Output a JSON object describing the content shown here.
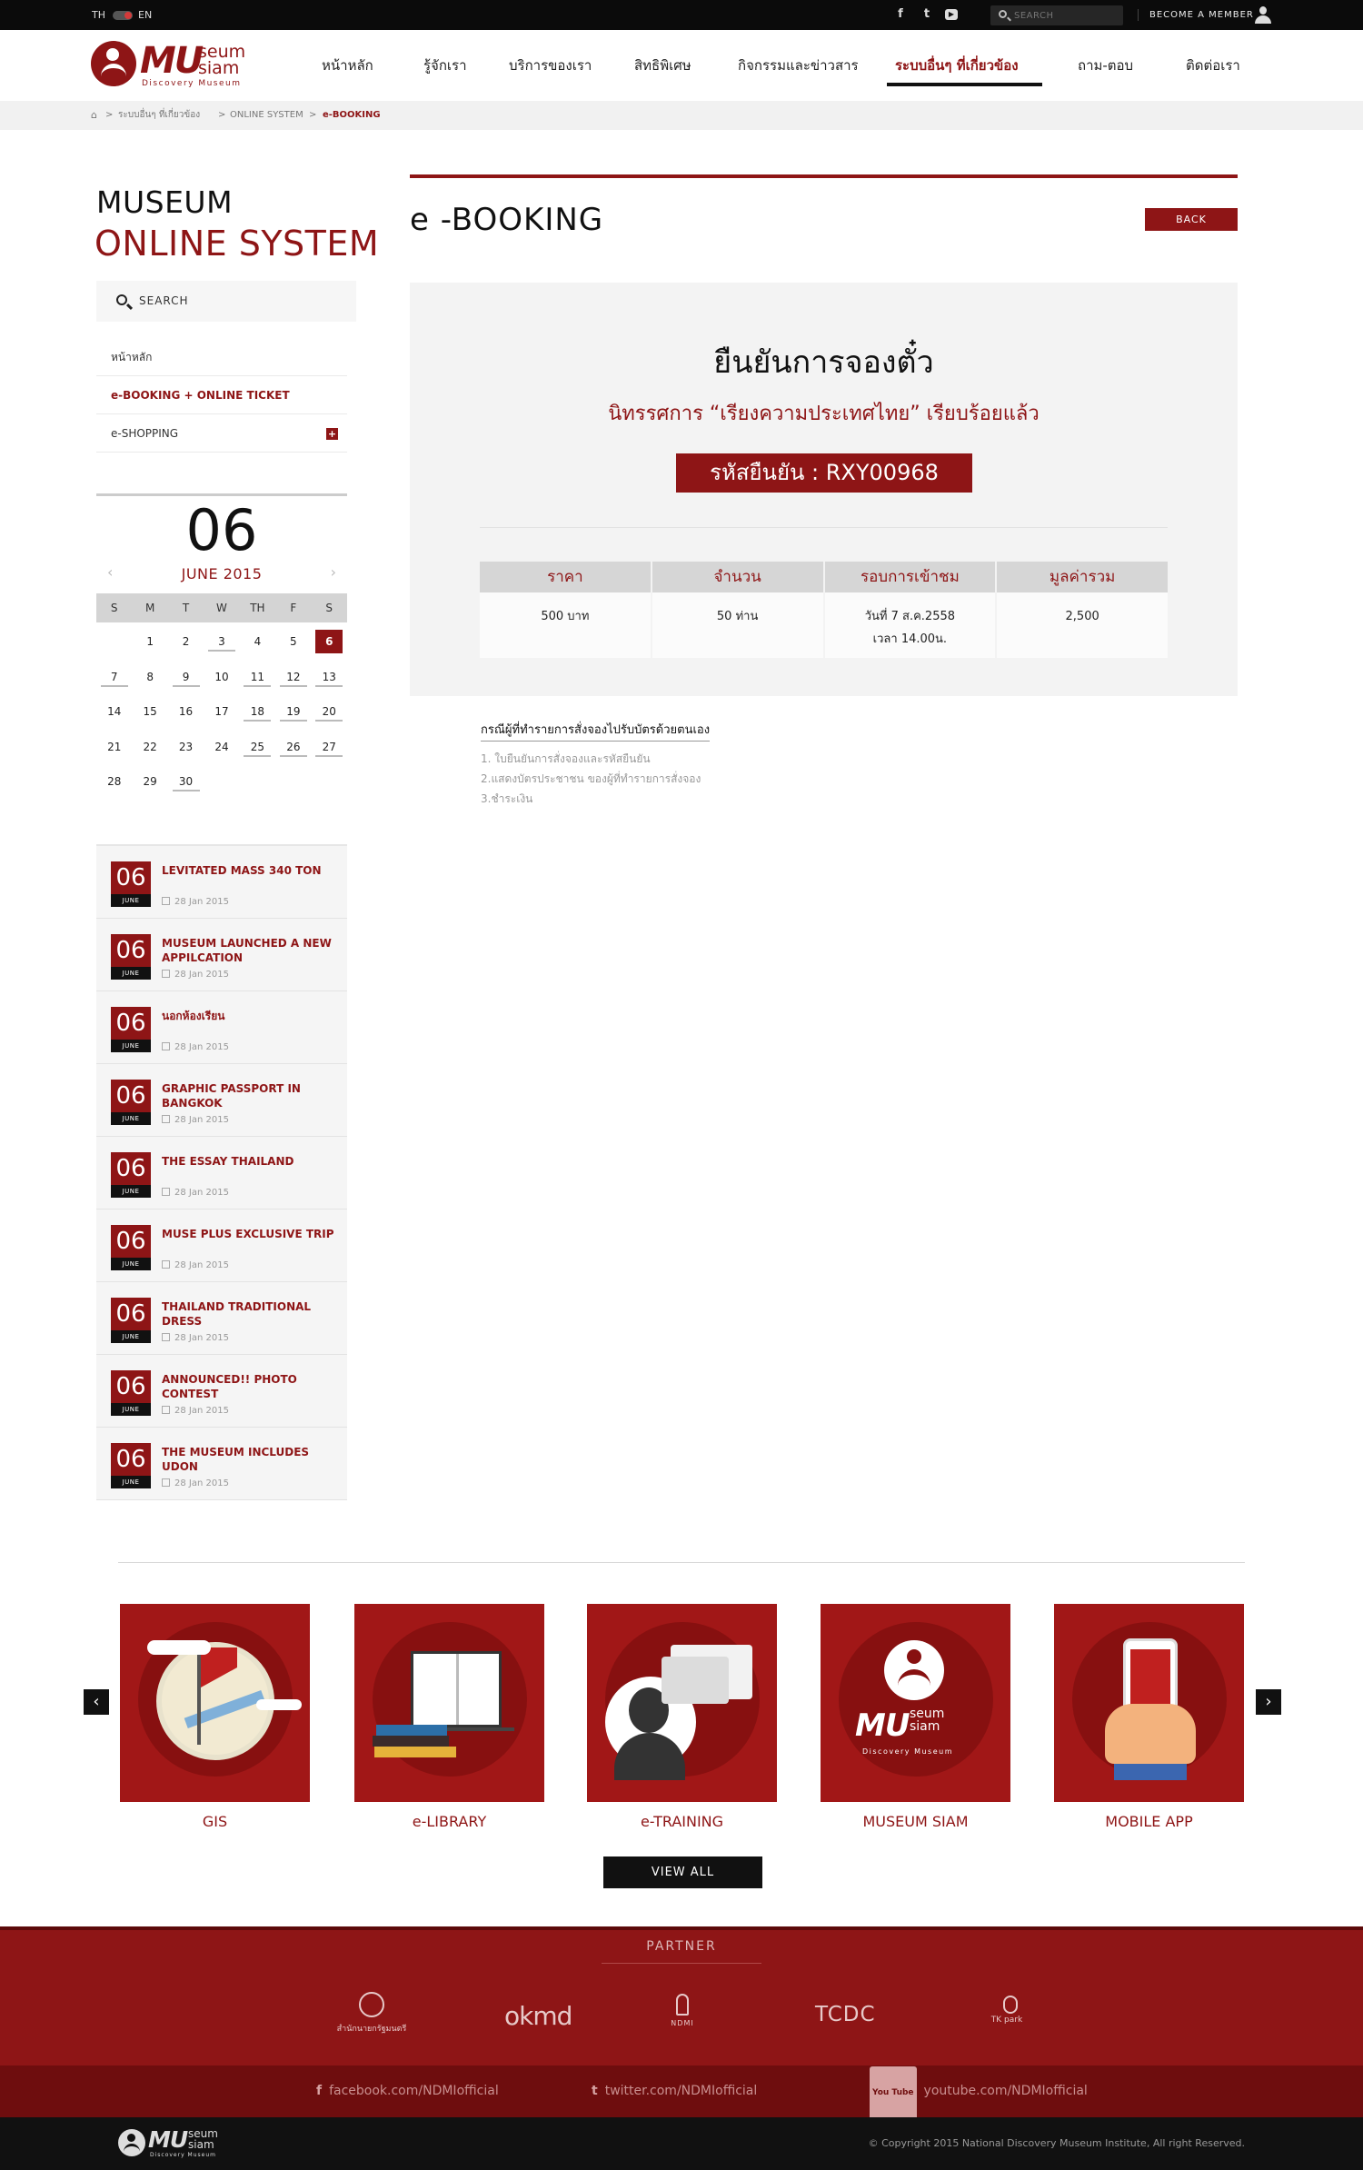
{
  "topbar": {
    "lang_th": "TH",
    "lang_en": "EN",
    "search_placeholder": "SEARCH",
    "member_label": "BECOME A MEMBER",
    "social_icons": [
      "facebook-icon",
      "twitter-icon",
      "youtube-icon"
    ]
  },
  "logo": {
    "mu": "MU",
    "seum": "seum",
    "siam": "siam",
    "subtitle": "Discovery Museum"
  },
  "nav": [
    {
      "label": "หน้าหลัก"
    },
    {
      "label": "รู้จักเรา"
    },
    {
      "label": "บริการของเรา"
    },
    {
      "label": "สิทธิพิเศษ"
    },
    {
      "label": "กิจกรรมและข่าวสาร"
    },
    {
      "label": "ระบบอื่นๆ ที่เกี่ยวข้อง",
      "active": true
    },
    {
      "label": "ถาม-ตอบ"
    },
    {
      "label": "ติดต่อเรา"
    }
  ],
  "breadcrumb": {
    "home_icon": "home-icon",
    "sep": ">",
    "items": [
      "ระบบอื่นๆ ที่เกี่ยวข้อง",
      "ONLINE SYSTEM",
      "e-BOOKING"
    ]
  },
  "sidebar": {
    "title_line1": "MUSEUM",
    "title_line2": "ONLINE SYSTEM",
    "search_label": "SEARCH",
    "menu": [
      {
        "label": "หน้าหลัก"
      },
      {
        "label": "e-BOOKING + ONLINE TICKET",
        "active": true
      },
      {
        "label": "e-SHOPPING",
        "expand": "+"
      }
    ]
  },
  "calendar": {
    "day": "06",
    "month": "JUNE 2015",
    "prev": "‹",
    "next": "›",
    "weekdays": [
      "S",
      "M",
      "T",
      "W",
      "TH",
      "F",
      "S"
    ],
    "selected": 6,
    "event_days": [
      3,
      7,
      9,
      11,
      12,
      13,
      18,
      19,
      20,
      25,
      26,
      27,
      30
    ],
    "first_weekday": 1,
    "days_in_month": 30
  },
  "news": [
    {
      "day": "06",
      "month": "JUNE",
      "title": "LEVITATED MASS 340 TON",
      "date": "28 Jan 2015"
    },
    {
      "day": "06",
      "month": "JUNE",
      "title": "MUSEUM LAUNCHED A NEW APPILCATION",
      "date": "28 Jan 2015"
    },
    {
      "day": "06",
      "month": "JUNE",
      "title": "นอกห้องเรียน",
      "date": "28 Jan 2015"
    },
    {
      "day": "06",
      "month": "JUNE",
      "title": "GRAPHIC PASSPORT IN BANGKOK",
      "date": "28 Jan 2015"
    },
    {
      "day": "06",
      "month": "JUNE",
      "title": "THE ESSAY THAILAND",
      "date": "28 Jan 2015"
    },
    {
      "day": "06",
      "month": "JUNE",
      "title": "MUSE PLUS EXCLUSIVE TRIP",
      "date": "28 Jan 2015"
    },
    {
      "day": "06",
      "month": "JUNE",
      "title": "THAILAND TRADITIONAL DRESS",
      "date": "28 Jan 2015"
    },
    {
      "day": "06",
      "month": "JUNE",
      "title": "ANNOUNCED!! PHOTO CONTEST",
      "date": "28 Jan 2015"
    },
    {
      "day": "06",
      "month": "JUNE",
      "title": "THE MUSEUM INCLUDES UDON",
      "date": "28 Jan 2015"
    }
  ],
  "main": {
    "title": "e -BOOKING",
    "back_label": "BACK",
    "confirm_title": "ยืนยันการจองตั๋ว",
    "confirm_subtitle": "นิทรรศการ “เรียงความประเทศไทย” เรียบร้อยแล้ว",
    "confirm_code": "รหัสยืนยัน : RXY00968",
    "table": {
      "headers": [
        "ราคา",
        "จำนวน",
        "รอบการเข้าชม",
        "มูลค่ารวม"
      ],
      "row": [
        "500 บาท",
        "50 ท่าน",
        "วันที่ 7 ส.ค.2558\nเวลา 14.00น.",
        "2,500"
      ]
    },
    "notes_title": "กรณีผู้ที่ทำรายการสั่งจองไปรับบัตรด้วยตนเอง",
    "notes": [
      "1. ใบยืนยันการสั่งจองและรหัสยืนยัน",
      "2.แสดงบัตรประชาชน ของผู้ที่ทำรายการสั่งจอง",
      "3.ชำระเงิน"
    ]
  },
  "features": {
    "prev": "‹",
    "next": "›",
    "items": [
      {
        "label": "GIS",
        "icon": "map-flag-icon"
      },
      {
        "label": "e-LIBRARY",
        "icon": "book-icon"
      },
      {
        "label": "e-TRAINING",
        "icon": "person-chat-icon"
      },
      {
        "label": "MUSEUM SIAM",
        "icon": "museum-siam-logo"
      },
      {
        "label": "MOBILE APP",
        "icon": "phone-hand-icon"
      }
    ],
    "view_all": "VIEW ALL"
  },
  "footer": {
    "partner_title": "PARTNER",
    "partners": [
      "สำนักนายกรัฐมนตรี",
      "okmd",
      "NDMI",
      "TCDC",
      "TK park"
    ],
    "social": [
      {
        "icon": "f",
        "label": "facebook.com/NDMIofficial"
      },
      {
        "icon": "t",
        "label": "twitter.com/NDMIofficial"
      },
      {
        "icon": "You Tube",
        "label": "youtube.com/NDMIofficial"
      }
    ],
    "copyright": "© Copyright 2015 National Discovery Museum Institute, All right Reserved."
  }
}
